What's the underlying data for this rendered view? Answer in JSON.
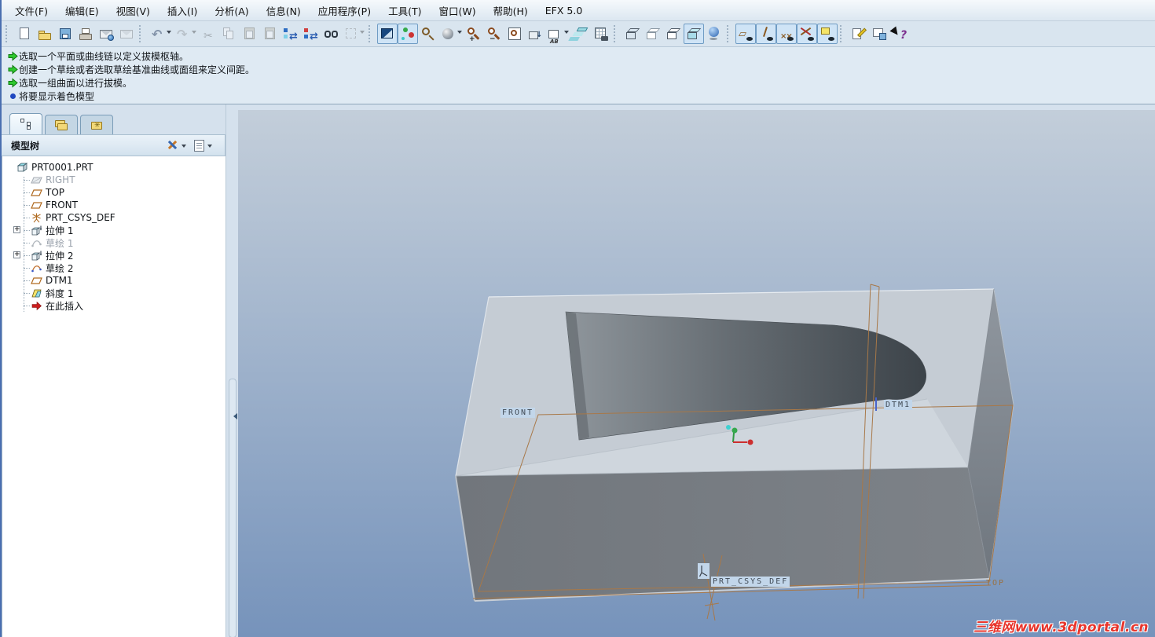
{
  "menu": {
    "items": [
      "文件(F)",
      "编辑(E)",
      "视图(V)",
      "插入(I)",
      "分析(A)",
      "信息(N)",
      "应用程序(P)",
      "工具(T)",
      "窗口(W)",
      "帮助(H)",
      "EFX 5.0"
    ]
  },
  "toolbar": {
    "icons": [
      {
        "name": "toolbar-grip",
        "cls": "tb-grip",
        "interactable": false
      },
      {
        "name": "new-file-button",
        "cls": "i-new",
        "interactable": true
      },
      {
        "name": "open-button",
        "cls": "i-open",
        "interactable": true
      },
      {
        "name": "save-button",
        "cls": "i-save",
        "interactable": true
      },
      {
        "name": "print-button",
        "cls": "i-print",
        "interactable": true
      },
      {
        "name": "email-button",
        "cls": "i-email",
        "interactable": true
      },
      {
        "name": "send-button",
        "cls": "i-email2 dis",
        "interactable": false
      },
      {
        "name": "toolbar-grip",
        "cls": "tb-grip",
        "interactable": false
      },
      {
        "name": "undo-button",
        "cls": "i-undo car",
        "interactable": true
      },
      {
        "name": "redo-button",
        "cls": "i-redo car dis",
        "interactable": false
      },
      {
        "name": "cut-button",
        "cls": "i-cut dis",
        "interactable": false
      },
      {
        "name": "copy-button",
        "cls": "i-copy dis",
        "interactable": false
      },
      {
        "name": "paste-button",
        "cls": "i-paste dis",
        "interactable": false
      },
      {
        "name": "paste-special-button",
        "cls": "i-paste2 dis",
        "interactable": false
      },
      {
        "name": "regenerate-button",
        "cls": "i-regen1",
        "interactable": true
      },
      {
        "name": "regenerate-manager-button",
        "cls": "i-regen2",
        "interactable": true
      },
      {
        "name": "find-button",
        "cls": "i-find",
        "interactable": true
      },
      {
        "name": "select-rect-button",
        "cls": "i-select car dis",
        "interactable": false
      },
      {
        "name": "toolbar-grip",
        "cls": "tb-grip",
        "interactable": false
      },
      {
        "name": "repaint-button",
        "cls": "i-repaint on",
        "interactable": true
      },
      {
        "name": "spin-center-toggle",
        "cls": "i-spin on",
        "interactable": true
      },
      {
        "name": "orient-mode-button",
        "cls": "i-orient",
        "interactable": true
      },
      {
        "name": "appearance-gallery-button",
        "cls": "i-sphere car",
        "interactable": true
      },
      {
        "name": "zoom-in-button",
        "cls": "i-zin",
        "interactable": true
      },
      {
        "name": "zoom-out-button",
        "cls": "i-zout",
        "interactable": true
      },
      {
        "name": "refit-button",
        "cls": "i-refit",
        "interactable": true
      },
      {
        "name": "reorient-button",
        "cls": "i-reorient",
        "interactable": true
      },
      {
        "name": "saved-views-button",
        "cls": "i-views car",
        "interactable": true
      },
      {
        "name": "layers-button",
        "cls": "i-layers",
        "interactable": true
      },
      {
        "name": "view-manager-button",
        "cls": "i-vmgr",
        "interactable": true
      },
      {
        "name": "toolbar-grip",
        "cls": "tb-grip",
        "interactable": false
      },
      {
        "name": "wireframe-button",
        "cls": "i-wire",
        "interactable": true
      },
      {
        "name": "hidden-line-button",
        "cls": "i-hidden",
        "interactable": true
      },
      {
        "name": "no-hidden-button",
        "cls": "i-nohidden",
        "interactable": true
      },
      {
        "name": "shaded-button",
        "cls": "i-shaded on",
        "interactable": true
      },
      {
        "name": "enhanced-realism-toggle",
        "cls": "i-realism",
        "interactable": true
      },
      {
        "name": "toolbar-grip",
        "cls": "tb-grip",
        "interactable": false
      },
      {
        "name": "datum-planes-toggle",
        "cls": "i-dplane dat on",
        "interactable": true
      },
      {
        "name": "datum-axes-toggle",
        "cls": "i-daxis dat on",
        "interactable": true
      },
      {
        "name": "datum-points-toggle",
        "cls": "i-dpoint dat on",
        "interactable": true
      },
      {
        "name": "datum-csys-toggle",
        "cls": "i-dcsys dat on",
        "interactable": true
      },
      {
        "name": "annotations-toggle",
        "cls": "i-annot dat on",
        "interactable": true
      },
      {
        "name": "toolbar-grip",
        "cls": "tb-grip",
        "interactable": false
      },
      {
        "name": "edit-object-button",
        "cls": "i-editobj",
        "interactable": true
      },
      {
        "name": "window-save-button",
        "cls": "i-winsave",
        "interactable": true
      },
      {
        "name": "context-help-button",
        "cls": "i-help",
        "interactable": true
      }
    ]
  },
  "messages": [
    {
      "icon": "green-arrow-icon",
      "text": "选取一个平面或曲线链以定义拔模枢轴。"
    },
    {
      "icon": "green-arrow-icon",
      "text": "创建一个草绘或者选取草绘基准曲线或面组来定义间距。"
    },
    {
      "icon": "green-arrow-icon",
      "text": "选取一组曲面以进行拔模。"
    },
    {
      "icon": "blue-dot-icon",
      "text": "将要显示着色模型"
    }
  ],
  "navigator": {
    "header": {
      "title": "模型树"
    }
  },
  "tree": {
    "items": [
      {
        "label": "PRT0001.PRT",
        "icon": "part-icon"
      },
      {
        "label": "RIGHT",
        "icon": "datum-plane-icon",
        "grayed": true
      },
      {
        "label": "TOP",
        "icon": "datum-plane-icon"
      },
      {
        "label": "FRONT",
        "icon": "datum-plane-icon"
      },
      {
        "label": "PRT_CSYS_DEF",
        "icon": "csys-icon"
      },
      {
        "label": "拉伸 1",
        "icon": "extrude-icon",
        "expandable": true
      },
      {
        "label": "草绘 1",
        "icon": "sketch-icon",
        "grayed": true
      },
      {
        "label": "拉伸 2",
        "icon": "extrude-icon",
        "expandable": true
      },
      {
        "label": "草绘 2",
        "icon": "sketch-icon"
      },
      {
        "label": "DTM1",
        "icon": "datum-plane-icon"
      },
      {
        "label": "斜度 1",
        "icon": "draft-icon"
      },
      {
        "label": "在此插入",
        "icon": "insert-here-icon"
      }
    ]
  },
  "viewport": {
    "labels": {
      "front": "FRONT",
      "dtm1": "DTM1",
      "csys": "PRT_CSYS_DEF",
      "top": "TOP"
    },
    "colors": {
      "background_top": "#c3ceda",
      "background_bottom": "#7693bb",
      "datum_outline": "#a87848",
      "label_highlight": "#c2d6ea",
      "model_top_face": "#c5ccd4",
      "model_front_face": "#777c82",
      "cut_dark": "#3d4349"
    }
  },
  "watermark": {
    "site": "三维网",
    "url": "www.3dportal.cn",
    "color": "#e8352c"
  }
}
